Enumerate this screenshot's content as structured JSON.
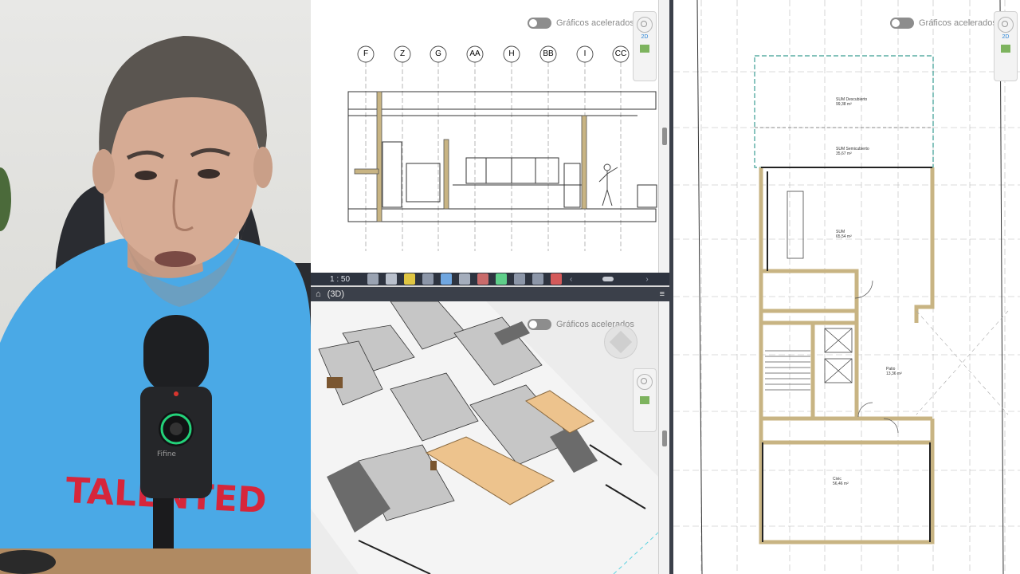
{
  "toggles": {
    "accel_label": "Gráficos acelerados"
  },
  "grid_bubbles": [
    "F",
    "Z",
    "G",
    "AA",
    "H",
    "BB",
    "I",
    "CC"
  ],
  "section_view": {
    "scale": "1 : 50"
  },
  "view3d": {
    "tab_label": "(3D)"
  },
  "navbar": {
    "top_label": "2D"
  },
  "webcam": {
    "shirt_text": "TALENTED",
    "mic_brand": "Fifine"
  },
  "plan_rooms": [
    {
      "name": "SUM Descubierto",
      "area": "99,38 m²"
    },
    {
      "name": "SUM Semicubierto",
      "area": "35,67 m²"
    },
    {
      "name": "SUM",
      "area": "65,54 m²"
    },
    {
      "name": "Patio",
      "area": "13,36 m²"
    },
    {
      "name": "Civic",
      "area": "56,46 m²"
    }
  ],
  "colors": {
    "toolbar_bg": "#2e3440",
    "accent_blue": "#2a84d6",
    "wall_tan": "#c8b483",
    "shirt_blue": "#4aa9e6",
    "text_red": "#d6263b"
  }
}
